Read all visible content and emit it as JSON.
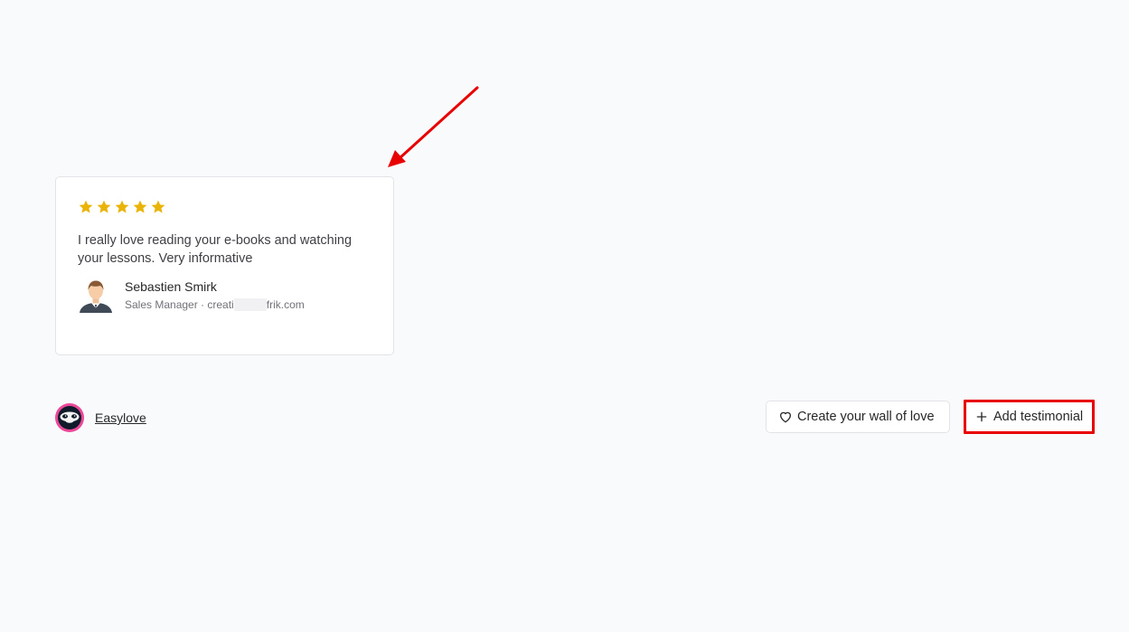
{
  "testimonial": {
    "rating": 5,
    "text": "I really love reading your e-books and watching your lessons. Very informative",
    "author_name": "Sebastien Smirk",
    "author_role": "Sales Manager · creati",
    "author_domain_suffix": "frik.com"
  },
  "footer": {
    "brand_name": "Easylove",
    "wall_button_label": "Create your wall of love",
    "add_button_label": "Add testimonial"
  },
  "colors": {
    "star": "#eab308",
    "annotation": "#e80000",
    "brand_ring": "#ec4899"
  }
}
